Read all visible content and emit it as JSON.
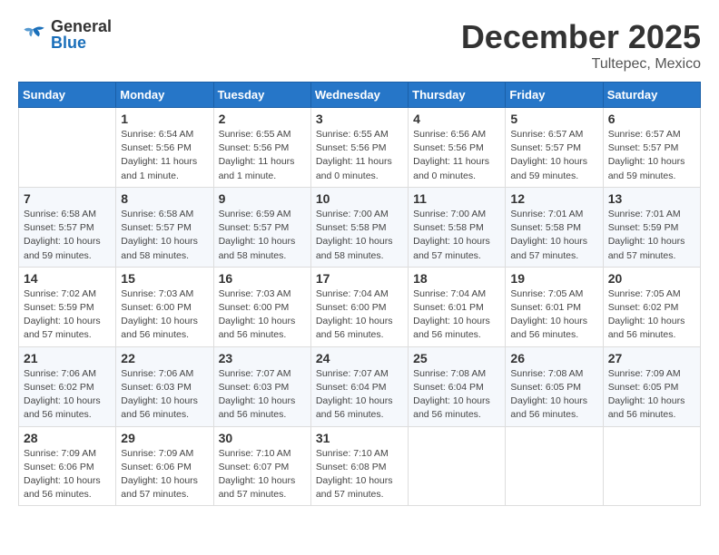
{
  "header": {
    "logo_general": "General",
    "logo_blue": "Blue",
    "month": "December 2025",
    "location": "Tultepec, Mexico"
  },
  "weekdays": [
    "Sunday",
    "Monday",
    "Tuesday",
    "Wednesday",
    "Thursday",
    "Friday",
    "Saturday"
  ],
  "weeks": [
    [
      {
        "day": "",
        "info": ""
      },
      {
        "day": "1",
        "info": "Sunrise: 6:54 AM\nSunset: 5:56 PM\nDaylight: 11 hours\nand 1 minute."
      },
      {
        "day": "2",
        "info": "Sunrise: 6:55 AM\nSunset: 5:56 PM\nDaylight: 11 hours\nand 1 minute."
      },
      {
        "day": "3",
        "info": "Sunrise: 6:55 AM\nSunset: 5:56 PM\nDaylight: 11 hours\nand 0 minutes."
      },
      {
        "day": "4",
        "info": "Sunrise: 6:56 AM\nSunset: 5:56 PM\nDaylight: 11 hours\nand 0 minutes."
      },
      {
        "day": "5",
        "info": "Sunrise: 6:57 AM\nSunset: 5:57 PM\nDaylight: 10 hours\nand 59 minutes."
      },
      {
        "day": "6",
        "info": "Sunrise: 6:57 AM\nSunset: 5:57 PM\nDaylight: 10 hours\nand 59 minutes."
      }
    ],
    [
      {
        "day": "7",
        "info": "Sunrise: 6:58 AM\nSunset: 5:57 PM\nDaylight: 10 hours\nand 59 minutes."
      },
      {
        "day": "8",
        "info": "Sunrise: 6:58 AM\nSunset: 5:57 PM\nDaylight: 10 hours\nand 58 minutes."
      },
      {
        "day": "9",
        "info": "Sunrise: 6:59 AM\nSunset: 5:57 PM\nDaylight: 10 hours\nand 58 minutes."
      },
      {
        "day": "10",
        "info": "Sunrise: 7:00 AM\nSunset: 5:58 PM\nDaylight: 10 hours\nand 58 minutes."
      },
      {
        "day": "11",
        "info": "Sunrise: 7:00 AM\nSunset: 5:58 PM\nDaylight: 10 hours\nand 57 minutes."
      },
      {
        "day": "12",
        "info": "Sunrise: 7:01 AM\nSunset: 5:58 PM\nDaylight: 10 hours\nand 57 minutes."
      },
      {
        "day": "13",
        "info": "Sunrise: 7:01 AM\nSunset: 5:59 PM\nDaylight: 10 hours\nand 57 minutes."
      }
    ],
    [
      {
        "day": "14",
        "info": "Sunrise: 7:02 AM\nSunset: 5:59 PM\nDaylight: 10 hours\nand 57 minutes."
      },
      {
        "day": "15",
        "info": "Sunrise: 7:03 AM\nSunset: 6:00 PM\nDaylight: 10 hours\nand 56 minutes."
      },
      {
        "day": "16",
        "info": "Sunrise: 7:03 AM\nSunset: 6:00 PM\nDaylight: 10 hours\nand 56 minutes."
      },
      {
        "day": "17",
        "info": "Sunrise: 7:04 AM\nSunset: 6:00 PM\nDaylight: 10 hours\nand 56 minutes."
      },
      {
        "day": "18",
        "info": "Sunrise: 7:04 AM\nSunset: 6:01 PM\nDaylight: 10 hours\nand 56 minutes."
      },
      {
        "day": "19",
        "info": "Sunrise: 7:05 AM\nSunset: 6:01 PM\nDaylight: 10 hours\nand 56 minutes."
      },
      {
        "day": "20",
        "info": "Sunrise: 7:05 AM\nSunset: 6:02 PM\nDaylight: 10 hours\nand 56 minutes."
      }
    ],
    [
      {
        "day": "21",
        "info": "Sunrise: 7:06 AM\nSunset: 6:02 PM\nDaylight: 10 hours\nand 56 minutes."
      },
      {
        "day": "22",
        "info": "Sunrise: 7:06 AM\nSunset: 6:03 PM\nDaylight: 10 hours\nand 56 minutes."
      },
      {
        "day": "23",
        "info": "Sunrise: 7:07 AM\nSunset: 6:03 PM\nDaylight: 10 hours\nand 56 minutes."
      },
      {
        "day": "24",
        "info": "Sunrise: 7:07 AM\nSunset: 6:04 PM\nDaylight: 10 hours\nand 56 minutes."
      },
      {
        "day": "25",
        "info": "Sunrise: 7:08 AM\nSunset: 6:04 PM\nDaylight: 10 hours\nand 56 minutes."
      },
      {
        "day": "26",
        "info": "Sunrise: 7:08 AM\nSunset: 6:05 PM\nDaylight: 10 hours\nand 56 minutes."
      },
      {
        "day": "27",
        "info": "Sunrise: 7:09 AM\nSunset: 6:05 PM\nDaylight: 10 hours\nand 56 minutes."
      }
    ],
    [
      {
        "day": "28",
        "info": "Sunrise: 7:09 AM\nSunset: 6:06 PM\nDaylight: 10 hours\nand 56 minutes."
      },
      {
        "day": "29",
        "info": "Sunrise: 7:09 AM\nSunset: 6:06 PM\nDaylight: 10 hours\nand 57 minutes."
      },
      {
        "day": "30",
        "info": "Sunrise: 7:10 AM\nSunset: 6:07 PM\nDaylight: 10 hours\nand 57 minutes."
      },
      {
        "day": "31",
        "info": "Sunrise: 7:10 AM\nSunset: 6:08 PM\nDaylight: 10 hours\nand 57 minutes."
      },
      {
        "day": "",
        "info": ""
      },
      {
        "day": "",
        "info": ""
      },
      {
        "day": "",
        "info": ""
      }
    ]
  ]
}
